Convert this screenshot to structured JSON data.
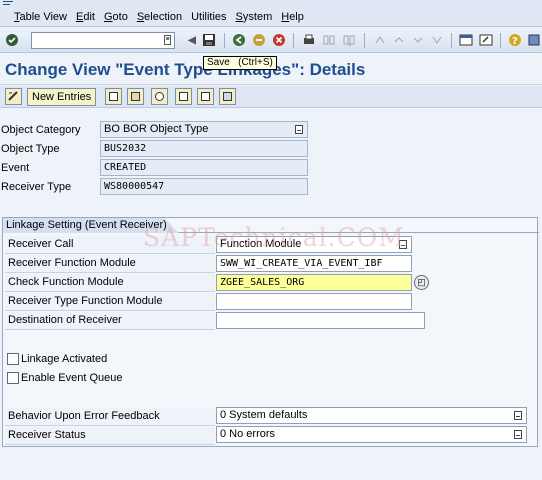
{
  "menubar": {
    "items": [
      "Table View",
      "Edit",
      "Goto",
      "Selection",
      "Utilities",
      "System",
      "Help"
    ]
  },
  "toolbar": {
    "command_field_value": "",
    "tooltip": "Save   (Ctrl+S)"
  },
  "page": {
    "title": "Change View \"Event Type Linkages\": Details"
  },
  "app_toolbar": {
    "new_entries_label": "New Entries"
  },
  "header_fields": [
    {
      "label": "Object Category",
      "value": "BO BOR Object Type"
    },
    {
      "label": "Object Type",
      "value": "BUS2032"
    },
    {
      "label": "Event",
      "value": "CREATED"
    },
    {
      "label": "Receiver Type",
      "value": "WS80000547"
    }
  ],
  "linkage": {
    "group_title": "Linkage Setting (Event Receiver)",
    "receiver_call_label": "Receiver Call",
    "receiver_call_value": "Function Module",
    "receiver_fm_label": "Receiver Function Module",
    "receiver_fm_value": "SWW_WI_CREATE_VIA_EVENT_IBF",
    "check_fm_label": "Check Function Module",
    "check_fm_value": "ZGEE_SALES_ORG",
    "receiver_type_fm_label": "Receiver Type Function Module",
    "receiver_type_fm_value": "",
    "destination_label": "Destination of Receiver",
    "destination_value": "",
    "linkage_activated_label": "Linkage Activated",
    "linkage_activated_checked": false,
    "event_queue_label": "Enable Event Queue",
    "event_queue_checked": false,
    "error_feedback_label": "Behavior Upon Error Feedback",
    "error_feedback_value": "0 System defaults",
    "receiver_status_label": "Receiver Status",
    "receiver_status_value": "0 No errors"
  },
  "watermark": "SAPTechnical.COM",
  "colors": {
    "title": "#1f4d8f",
    "highlight_field": "#ffff99",
    "background": "#eef3f9"
  }
}
